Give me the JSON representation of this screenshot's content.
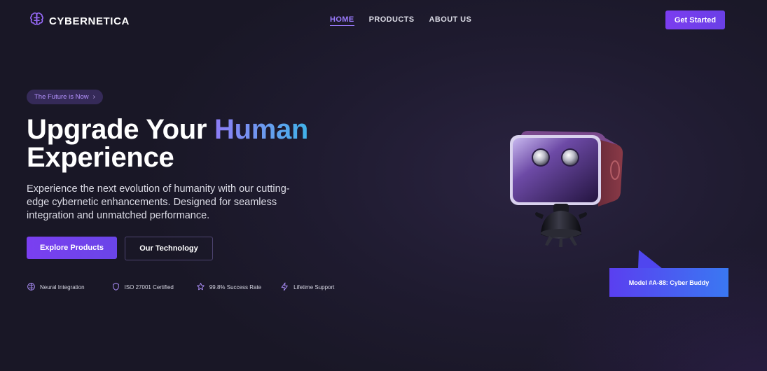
{
  "brand": {
    "name": "CYBERNETICA",
    "logo_icon": "brain-icon",
    "accent": "#7b3df0"
  },
  "nav": {
    "links": [
      {
        "label": "HOME",
        "active": true
      },
      {
        "label": "PRODUCTS",
        "active": false
      },
      {
        "label": "ABOUT US",
        "active": false
      }
    ],
    "cta_label": "Get Started"
  },
  "hero": {
    "badge": "The Future is Now",
    "title_line1_plain": "Upgrade Your ",
    "title_line1_accent": "Human",
    "title_line2": "Experience",
    "description": "Experience the next evolution of humanity with our cutting-edge cybernetic enhancements. Designed for seamless integration and unmatched performance.",
    "primary_button": "Explore Products",
    "secondary_button": "Our Technology",
    "features": [
      {
        "icon": "brain-icon",
        "label": "Neural Integration"
      },
      {
        "icon": "shield-icon",
        "label": "ISO 27001 Certified"
      },
      {
        "icon": "star-icon",
        "label": "99.8% Success Rate"
      },
      {
        "icon": "lightning-icon",
        "label": "Lifetime Support"
      }
    ]
  },
  "product": {
    "callout": "Model #A-88: Cyber Buddy",
    "callout_color_start": "#5a3ff0",
    "callout_color_end": "#3a78f2"
  }
}
